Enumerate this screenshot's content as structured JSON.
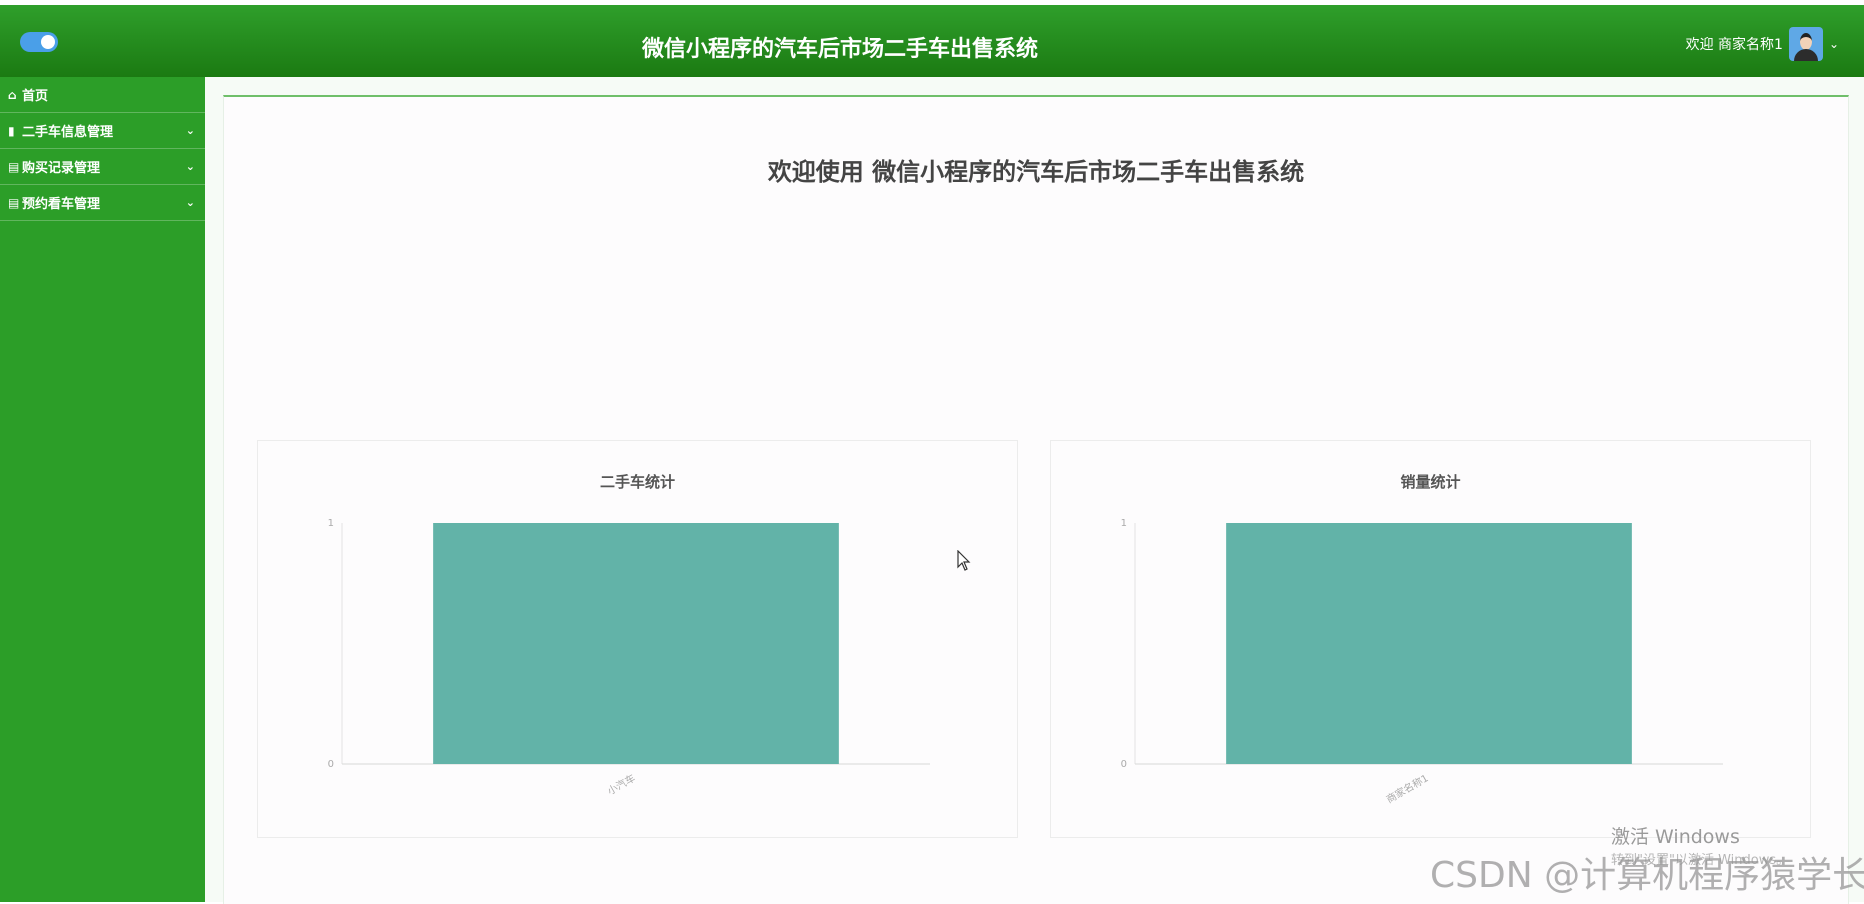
{
  "header": {
    "title": "微信小程序的汽车后市场二手车出售系统",
    "welcome": "欢迎 商家名称1"
  },
  "sidebar": {
    "items": [
      {
        "label": "首页",
        "icon": "home-icon",
        "has_submenu": false
      },
      {
        "label": "二手车信息管理",
        "icon": "folder-icon",
        "has_submenu": true
      },
      {
        "label": "购买记录管理",
        "icon": "list-icon",
        "has_submenu": true
      },
      {
        "label": "预约看车管理",
        "icon": "list-icon",
        "has_submenu": true
      }
    ]
  },
  "main": {
    "welcome_heading": "欢迎使用 微信小程序的汽车后市场二手车出售系统"
  },
  "colors": {
    "header": "#1f8c1a",
    "sidebar": "#2c9e28",
    "bar": "#62b3a8",
    "toggle": "#4a9fe8"
  },
  "chart_data": [
    {
      "type": "bar",
      "title": "二手车统计",
      "categories": [
        "小汽车"
      ],
      "values": [
        1
      ],
      "ylim": [
        0,
        1
      ],
      "y_ticks": [
        "0",
        "1"
      ],
      "xlabel": "",
      "ylabel": ""
    },
    {
      "type": "bar",
      "title": "销量统计",
      "categories": [
        "商家名称1"
      ],
      "values": [
        1
      ],
      "ylim": [
        0,
        1
      ],
      "y_ticks": [
        "0",
        "1"
      ],
      "xlabel": "",
      "ylabel": ""
    }
  ],
  "watermarks": {
    "windows_line1": "激活 Windows",
    "windows_line2": "转到\"设置\"以激活 Windows。",
    "csdn": "CSDN @计算机程序猿学长"
  }
}
